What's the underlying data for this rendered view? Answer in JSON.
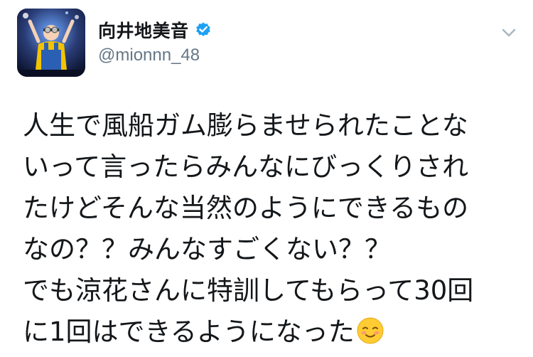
{
  "author": {
    "display_name": "向井地美音",
    "handle": "@mionnn_48",
    "verified": true
  },
  "icons": {
    "verified": "verified-badge-icon",
    "menu": "chevron-down-icon",
    "emoji": "smiling-face-emoji"
  },
  "colors": {
    "verified_blue": "#1da1f2",
    "handle_gray": "#657786",
    "text": "#14171a"
  },
  "tweet": {
    "lines": [
      "人生で風船ガム膨らませられたことな",
      "いって言ったらみんなにびっくりされ",
      "たけどそんな当然のようにできるもの",
      "なの？？みんなすごくない？？",
      "でも涼花さんに特訓してもらって30回",
      "に1回はできるようになった"
    ]
  }
}
